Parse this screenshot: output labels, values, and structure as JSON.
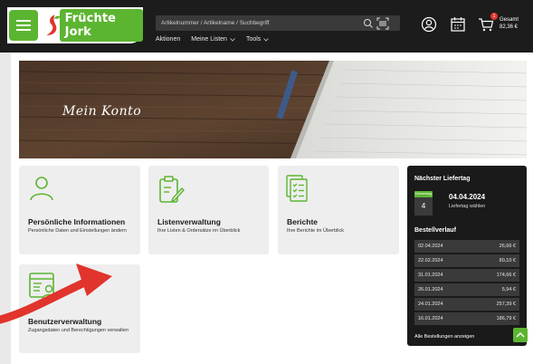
{
  "header": {
    "brand": "Früchte Jork",
    "search_placeholder": "Artikelnummer / Artikelname / Suchbegriff",
    "nav": [
      {
        "label": "Aktionen"
      },
      {
        "label": "Meine Listen"
      },
      {
        "label": "Tools"
      }
    ],
    "cart": {
      "badge": "1",
      "label": "Gesamt",
      "total": "82,36 €"
    }
  },
  "hero": {
    "title": "Mein Konto"
  },
  "cards": [
    {
      "title": "Persönliche Informationen",
      "desc": "Persönliche Daten und Einstellungen ändern",
      "icon": "user-icon"
    },
    {
      "title": "Listenverwaltung",
      "desc": "Ihre Listen & Ordersätze im Überblick",
      "icon": "clipboard-edit-icon"
    },
    {
      "title": "Berichte",
      "desc": "Ihre Berichte im Überblick",
      "icon": "report-icon"
    },
    {
      "title": "Benutzerverwaltung",
      "desc": "Zugangsdaten und Berechtigungen verwalten",
      "icon": "user-list-icon"
    }
  ],
  "panel": {
    "next_delivery_title": "Nächster Liefertag",
    "weekday": "Donnerstag",
    "day": "4",
    "date": "04.04.2024",
    "change_label": "Liefertag wählen",
    "history_title": "Bestellverlauf",
    "orders": [
      {
        "date": "02.04.2024",
        "amount": "26,66 €"
      },
      {
        "date": "22.02.2024",
        "amount": "80,10 €"
      },
      {
        "date": "31.01.2024",
        "amount": "174,66 €"
      },
      {
        "date": "26.01.2024",
        "amount": "5,94 €"
      },
      {
        "date": "24.01.2024",
        "amount": "257,39 €"
      },
      {
        "date": "16.01.2024",
        "amount": "186,79 €"
      }
    ],
    "all_orders_label": "Alle Bestellungen anzeigen"
  },
  "colors": {
    "accent": "#5cb531",
    "dark": "#1a1a1a",
    "arrow": "#e0342c"
  }
}
